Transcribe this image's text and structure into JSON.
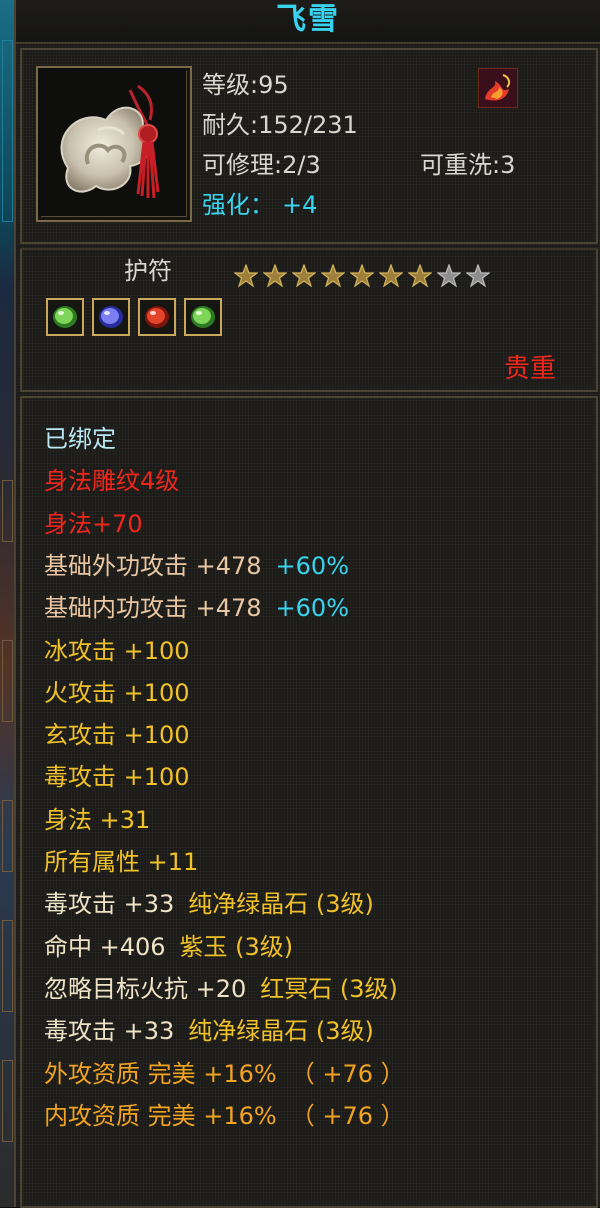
{
  "item": {
    "name": "飞雪",
    "level_label": "等级",
    "level": "95",
    "durability_label": "耐久",
    "durability": "152/231",
    "repairable_label": "可修理",
    "repairable": "2/3",
    "rewash_label": "可重洗",
    "rewash": "3",
    "enhance_label": "强化：",
    "enhance": "+4"
  },
  "type_label": "护符",
  "stars": {
    "filled": 7,
    "total": 9
  },
  "gems": [
    "green-gem-icon",
    "blue-gem-icon",
    "red-gem-icon",
    "green-gem-icon"
  ],
  "rarity": "贵重",
  "attributes": [
    {
      "text": "已绑定",
      "extra": "",
      "color": "pale"
    },
    {
      "text": "身法雕纹4级",
      "extra": "",
      "color": "red"
    },
    {
      "text": "身法+70",
      "extra": "",
      "color": "red"
    },
    {
      "text": "基础外功攻击  +478",
      "extra": "+60%",
      "color": "peach"
    },
    {
      "text": "基础内功攻击  +478",
      "extra": "+60%",
      "color": "peach"
    },
    {
      "text": "冰攻击  +100",
      "extra": "",
      "color": "gold"
    },
    {
      "text": "火攻击  +100",
      "extra": "",
      "color": "gold"
    },
    {
      "text": "玄攻击  +100",
      "extra": "",
      "color": "gold"
    },
    {
      "text": "毒攻击  +100",
      "extra": "",
      "color": "gold"
    },
    {
      "text": "身法  +31",
      "extra": "",
      "color": "gold"
    },
    {
      "text": "所有属性  +11",
      "extra": "",
      "color": "gold"
    },
    {
      "text": "毒攻击  +33",
      "extra": "纯净绿晶石 (3级)",
      "color": "cream"
    },
    {
      "text": "命中  +406",
      "extra": "紫玉 (3级)",
      "color": "cream"
    },
    {
      "text": "忽略目标火抗  +20",
      "extra": "红冥石 (3级)",
      "color": "cream"
    },
    {
      "text": "毒攻击  +33",
      "extra": "纯净绿晶石 (3级)",
      "color": "cream"
    },
    {
      "text": "外攻资质   完美  +16%",
      "extra": "（ +76 ）",
      "color": "orange"
    },
    {
      "text": "内攻资质   完美  +16%",
      "extra": "（ +76 ）",
      "color": "orange"
    }
  ],
  "colors": {
    "title": "#46c8e8",
    "red": "#f0261b",
    "cyan": "#38d4ef",
    "gold": "#f0c128",
    "orange": "#f2a421",
    "peach": "#eac7a2",
    "frame": "#4b4434"
  }
}
